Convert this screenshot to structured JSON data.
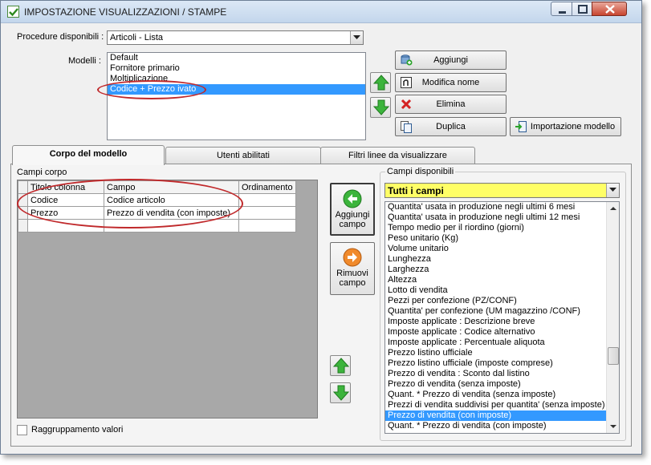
{
  "window": {
    "title": "IMPOSTAZIONE VISUALIZZAZIONI / STAMPE"
  },
  "procedure": {
    "label": "Procedure disponibili :",
    "value": "Articoli - Lista"
  },
  "models": {
    "label": "Modelli :",
    "items": [
      "Default",
      "Fornitore primario",
      "Moltiplicazione",
      "Codice + Prezzo ivato"
    ],
    "selected": "Codice + Prezzo ivato"
  },
  "buttons": {
    "add": "Aggiungi",
    "rename": "Modifica nome",
    "delete": "Elimina",
    "duplicate": "Duplica",
    "import": "Importazione modello"
  },
  "tabs": [
    "Corpo del modello",
    "Utenti abilitati",
    "Filtri linee da visualizzare"
  ],
  "body_fields": {
    "label": "Campi corpo",
    "columns": [
      "Titolo colonna",
      "Campo",
      "Ordinamento"
    ],
    "rows": [
      {
        "title": "Codice",
        "field": "Codice articolo",
        "order": ""
      },
      {
        "title": "Prezzo",
        "field": "Prezzo di vendita (con imposte)",
        "order": ""
      },
      {
        "title": "",
        "field": "",
        "order": ""
      }
    ]
  },
  "actions": {
    "add_field": "Aggiungi campo",
    "remove_field": "Rimuovi campo"
  },
  "available_fields": {
    "label": "Campi disponibili",
    "filter": "Tutti i campi",
    "items": [
      "Quantita' usata in produzione negli ultimi 6 mesi",
      "Quantita' usata in produzione negli ultimi 12 mesi",
      "Tempo medio per il riordino (giorni)",
      "Peso unitario (Kg)",
      "Volume unitario",
      "Lunghezza",
      "Larghezza",
      "Altezza",
      "Lotto di vendita",
      "Pezzi per confezione (PZ/CONF)",
      "Quantita' per confezione (UM magazzino /CONF)",
      "Imposte applicate : Descrizione breve",
      "Imposte applicate : Codice alternativo",
      "Imposte applicate : Percentuale aliquota",
      "Prezzo listino ufficiale",
      "Prezzo listino ufficiale (imposte comprese)",
      "Prezzo di vendita : Sconto dal listino",
      "Prezzo di vendita (senza imposte)",
      "Quant. * Prezzo di vendita (senza imposte)",
      "Prezzi di vendita suddivisi per quantita' (senza imposte)",
      "Prezzo di vendita (con imposte)",
      "Quant. * Prezzo di vendita (con imposte)"
    ],
    "selected_index": 20
  },
  "grouping": {
    "label": "Raggruppamento valori",
    "checked": false
  },
  "colors": {
    "selection": "#3399ff",
    "highlight_circle": "#c0292b",
    "filter_background": "#ffff66"
  }
}
